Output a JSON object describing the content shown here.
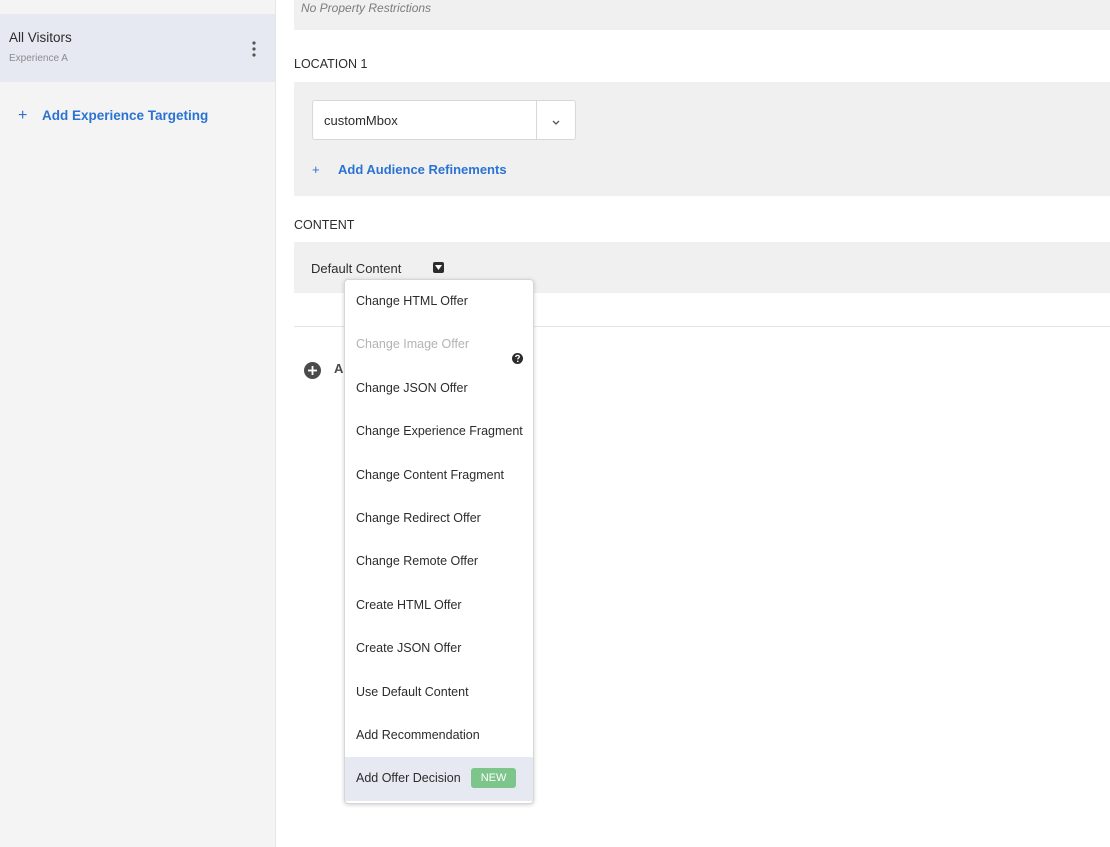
{
  "colors": {
    "accent": "#2b73d3",
    "badge_green": "#7dc58a",
    "selected_bg": "#e6e9f1",
    "panel_bg": "#f0f0f0"
  },
  "sidebar": {
    "experience": {
      "title": "All Visitors",
      "subtitle": "Experience A",
      "menu_icon": "kebab-icon"
    },
    "add_targeting": {
      "icon": "plus",
      "label": "Add Experience Targeting"
    }
  },
  "main": {
    "property_restrictions": "No Property Restrictions",
    "location": {
      "heading": "LOCATION 1",
      "select_value": "customMbox",
      "select_icon": "chevron-down-icon",
      "add_refinements": {
        "icon": "plus",
        "label": "Add Audience Refinements"
      }
    },
    "content": {
      "heading": "CONTENT",
      "default_content": "Default Content",
      "caret_icon": "caret-down-icon"
    },
    "add_partial": {
      "icon": "plus-circle-icon",
      "label": "A"
    }
  },
  "menu": {
    "items": [
      {
        "label": "Change HTML Offer"
      },
      {
        "label": "Change Image Offer",
        "disabled": true,
        "icon": "help-icon"
      },
      {
        "label": "Change JSON Offer"
      },
      {
        "label": "Change Experience Fragment"
      },
      {
        "label": "Change Content Fragment"
      },
      {
        "label": "Change Redirect Offer"
      },
      {
        "label": "Change Remote Offer"
      },
      {
        "label": "Create HTML Offer"
      },
      {
        "label": "Create JSON Offer"
      },
      {
        "label": "Use Default Content"
      },
      {
        "label": "Add Recommendation"
      },
      {
        "label": "Add Offer Decision",
        "active": true,
        "badge": "NEW"
      }
    ]
  }
}
